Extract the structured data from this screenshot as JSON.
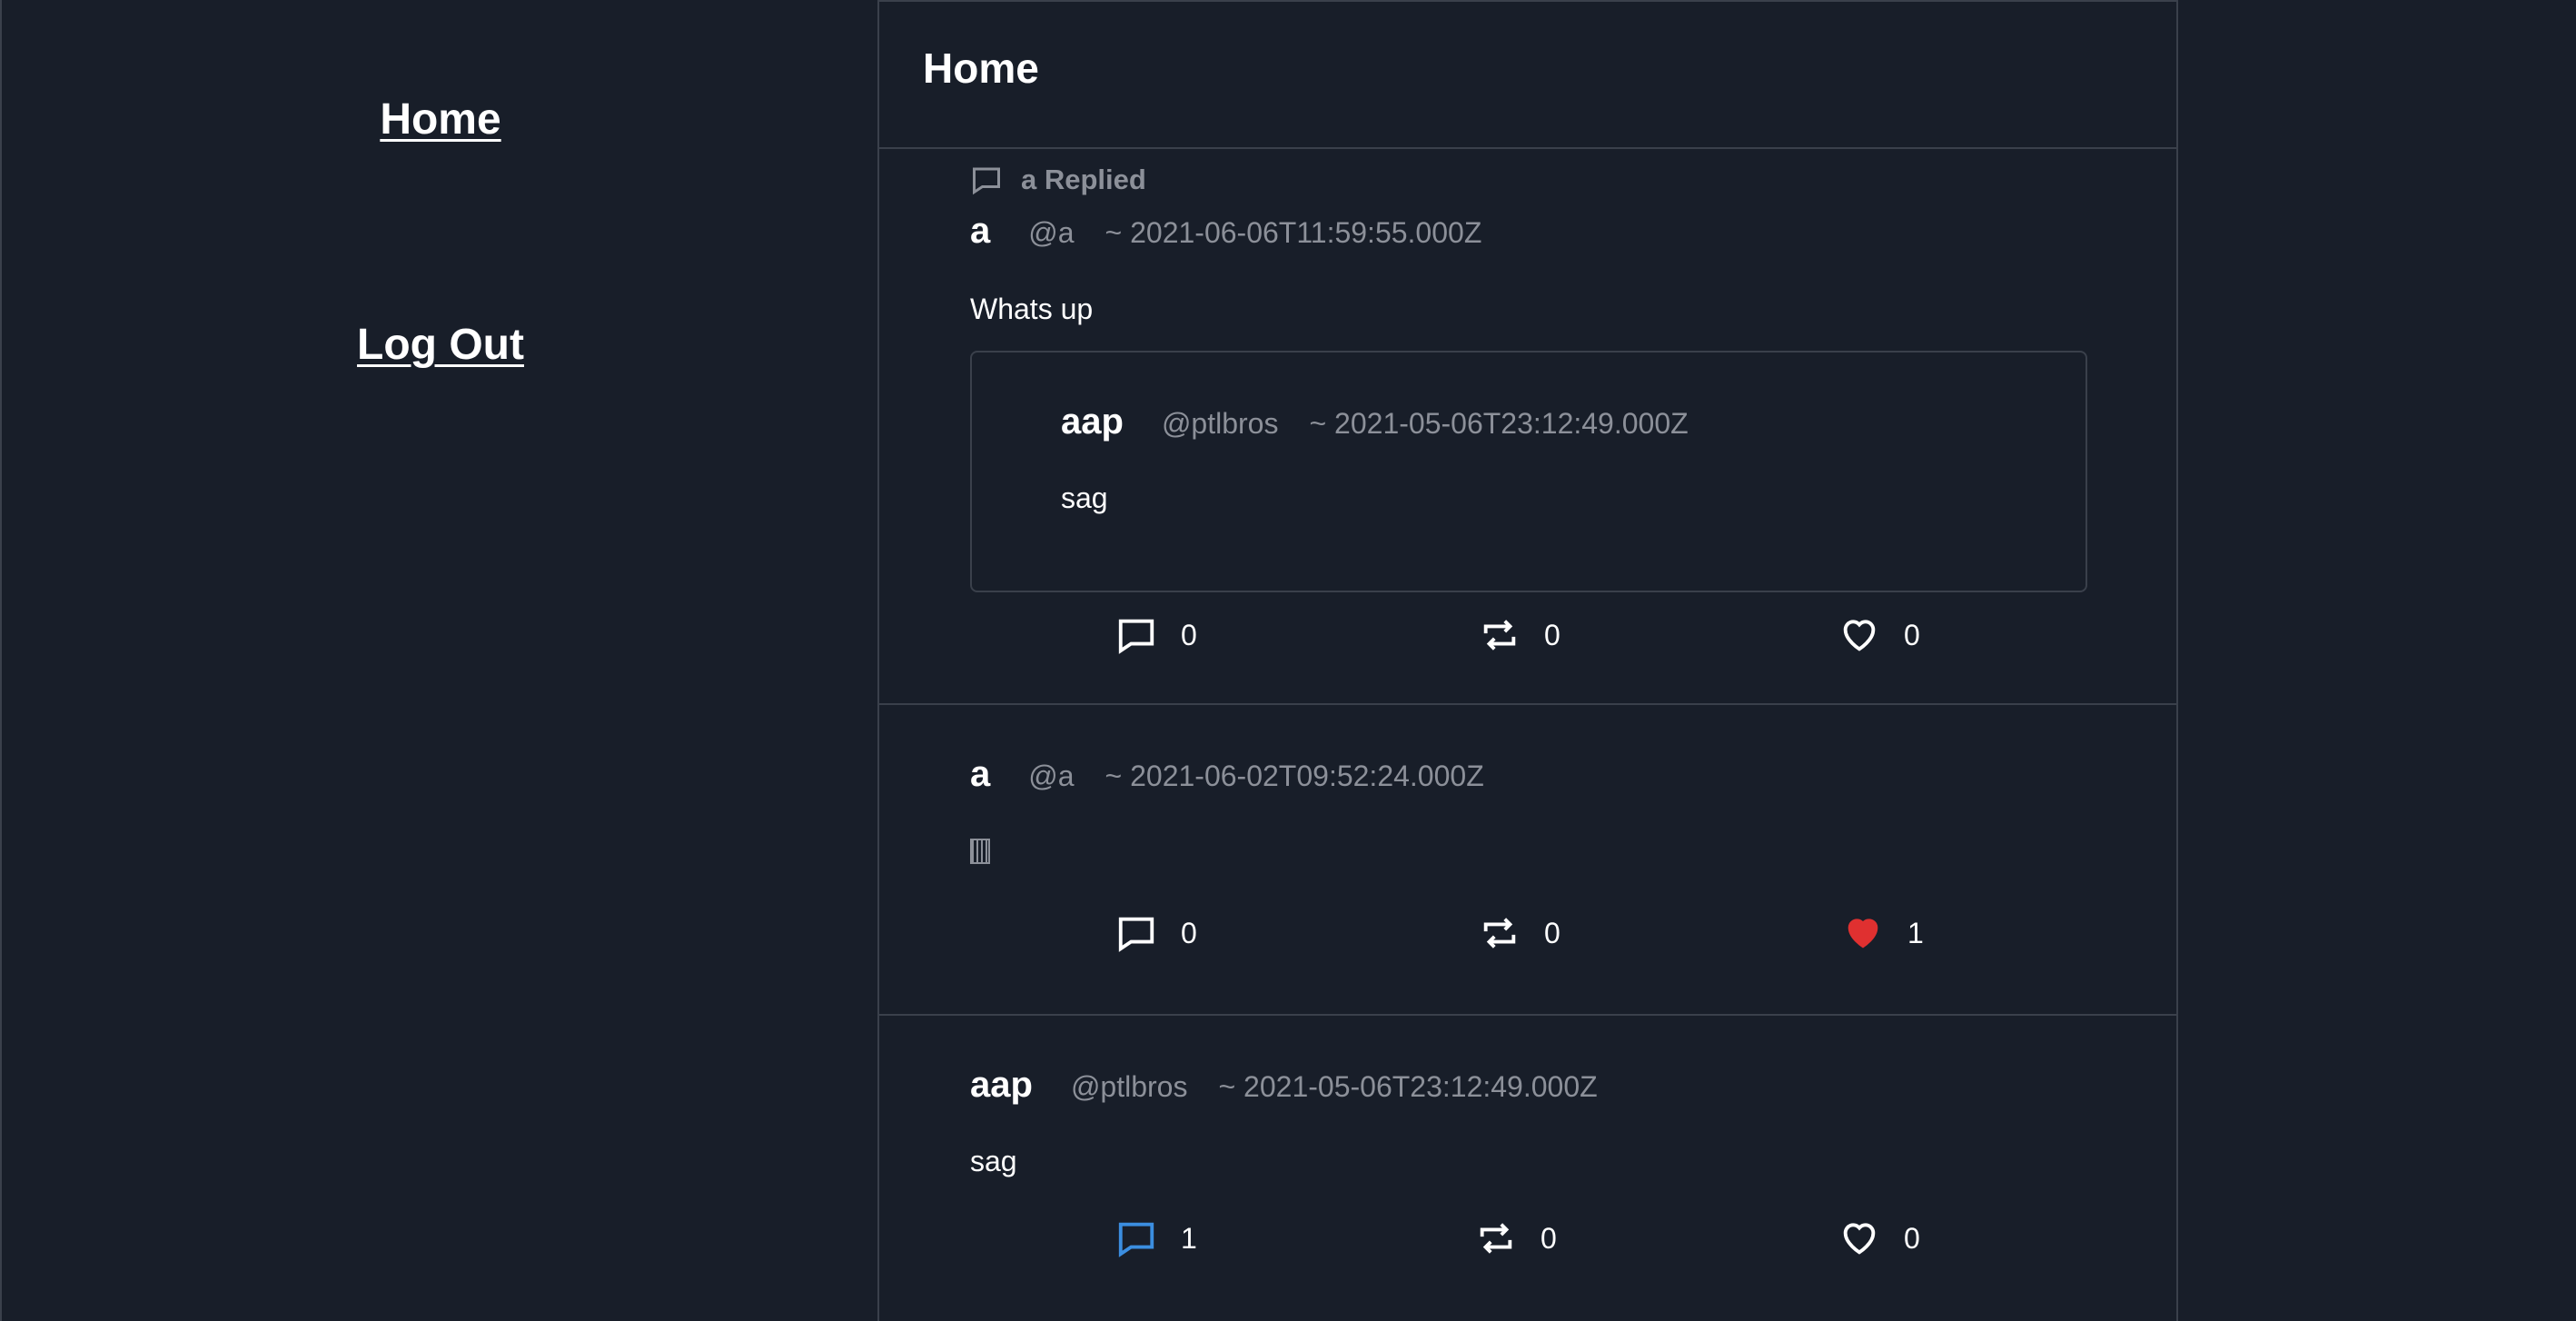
{
  "sidebar": {
    "home_label": "Home",
    "logout_label": "Log Out"
  },
  "header": {
    "title": "Home"
  },
  "colors": {
    "background": "#181e29",
    "border": "#3a404b",
    "muted_text": "#8c9099",
    "liked": "#e03030",
    "replied_accent": "#3b8ee0"
  },
  "posts": [
    {
      "replied_label": "a Replied",
      "name": "a",
      "handle": "@a",
      "time": "~ 2021-06-06T11:59:55.000Z",
      "text": "Whats up",
      "quote": {
        "name": "aap",
        "handle": "@ptlbros",
        "time": "~ 2021-05-06T23:12:49.000Z",
        "text": "sag"
      },
      "reply_count": "0",
      "retweet_count": "0",
      "like_count": "0"
    },
    {
      "name": "a",
      "handle": "@a",
      "time": "~ 2021-06-02T09:52:24.000Z",
      "text_icon": "unknown-glyph-icon",
      "reply_count": "0",
      "retweet_count": "0",
      "like_count": "1",
      "liked": true
    },
    {
      "name": "aap",
      "handle": "@ptlbros",
      "time": "~ 2021-05-06T23:12:49.000Z",
      "text": "sag",
      "reply_count": "1",
      "retweet_count": "0",
      "like_count": "0",
      "replied": true
    }
  ]
}
